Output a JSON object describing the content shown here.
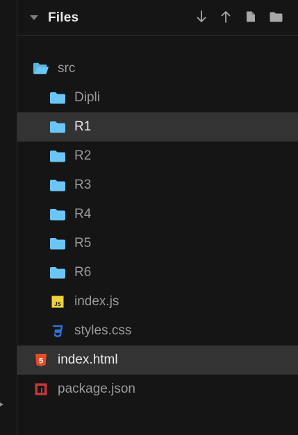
{
  "panel": {
    "title": "Files"
  },
  "toolbar": {
    "buttons": [
      {
        "icon": "download-icon"
      },
      {
        "icon": "upload-icon"
      },
      {
        "icon": "new-file-icon"
      },
      {
        "icon": "new-folder-icon"
      }
    ]
  },
  "tree": {
    "items": [
      {
        "label": "src",
        "icon": "folder-open-icon",
        "depth": 0,
        "selected": false
      },
      {
        "label": "Dipli",
        "icon": "folder-icon",
        "depth": 1,
        "selected": false
      },
      {
        "label": "R1",
        "icon": "folder-icon",
        "depth": 1,
        "selected": true
      },
      {
        "label": "R2",
        "icon": "folder-icon",
        "depth": 1,
        "selected": false
      },
      {
        "label": "R3",
        "icon": "folder-icon",
        "depth": 1,
        "selected": false
      },
      {
        "label": "R4",
        "icon": "folder-icon",
        "depth": 1,
        "selected": false
      },
      {
        "label": "R5",
        "icon": "folder-icon",
        "depth": 1,
        "selected": false
      },
      {
        "label": "R6",
        "icon": "folder-icon",
        "depth": 1,
        "selected": false
      },
      {
        "label": "index.js",
        "icon": "javascript-file-icon",
        "depth": 1,
        "selected": false,
        "badge": "JS"
      },
      {
        "label": "styles.css",
        "icon": "css-file-icon",
        "depth": 1,
        "selected": false
      },
      {
        "label": "index.html",
        "icon": "html-file-icon",
        "depth": 0,
        "selected": true,
        "badge": "5"
      },
      {
        "label": "package.json",
        "icon": "npm-package-icon",
        "depth": 0,
        "selected": false
      }
    ]
  },
  "colors": {
    "background": "#151515",
    "selected_row": "#333333",
    "folder": "#6cc6f5",
    "html": "#e44d26",
    "css": "#2f74d8",
    "js": "#f0d33a",
    "npm": "#c73636"
  }
}
